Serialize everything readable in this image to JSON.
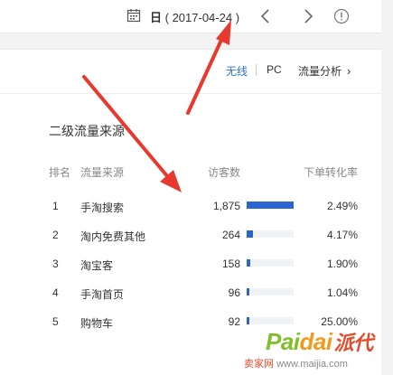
{
  "toolbar": {
    "date_prefix": "日",
    "date_value": "( 2017-04-24 )",
    "calendar_icon": "calendar-icon",
    "prev_icon": "chevron-left-icon",
    "next_icon": "chevron-right-icon",
    "info_icon": "info-icon"
  },
  "tabs": {
    "wifi_label": "无线",
    "pc_label": "PC",
    "analysis_label": "流量分析",
    "analysis_icon": "chevron-right-icon",
    "active_color": "#2f6fd4"
  },
  "section": {
    "title": "二级流量来源"
  },
  "table": {
    "headers": {
      "rank": "排名",
      "source": "流量来源",
      "visitors": "访客数",
      "conversion": "下单转化率"
    },
    "rows": [
      {
        "rank": "1",
        "source": "手淘搜索",
        "visitors": "1,875",
        "visitors_value": 1875,
        "conversion": "2.49%"
      },
      {
        "rank": "2",
        "source": "淘内免费其他",
        "visitors": "264",
        "visitors_value": 264,
        "conversion": "4.17%"
      },
      {
        "rank": "3",
        "source": "淘宝客",
        "visitors": "158",
        "visitors_value": 158,
        "conversion": "1.90%"
      },
      {
        "rank": "4",
        "source": "手淘首页",
        "visitors": "96",
        "visitors_value": 96,
        "conversion": "1.04%"
      },
      {
        "rank": "5",
        "source": "购物车",
        "visitors": "92",
        "visitors_value": 92,
        "conversion": "25.00%"
      }
    ],
    "bar_color": "#2b64d3",
    "bar_track_color": "#f0f2f5"
  },
  "annotation": {
    "arrow_color": "#e8392f"
  },
  "watermark": {
    "brand_pai": "Pai",
    "brand_dai": "dai",
    "brand_cn": "派代",
    "sub_red": "卖家网",
    "sub_url": "www.maijia.com"
  }
}
